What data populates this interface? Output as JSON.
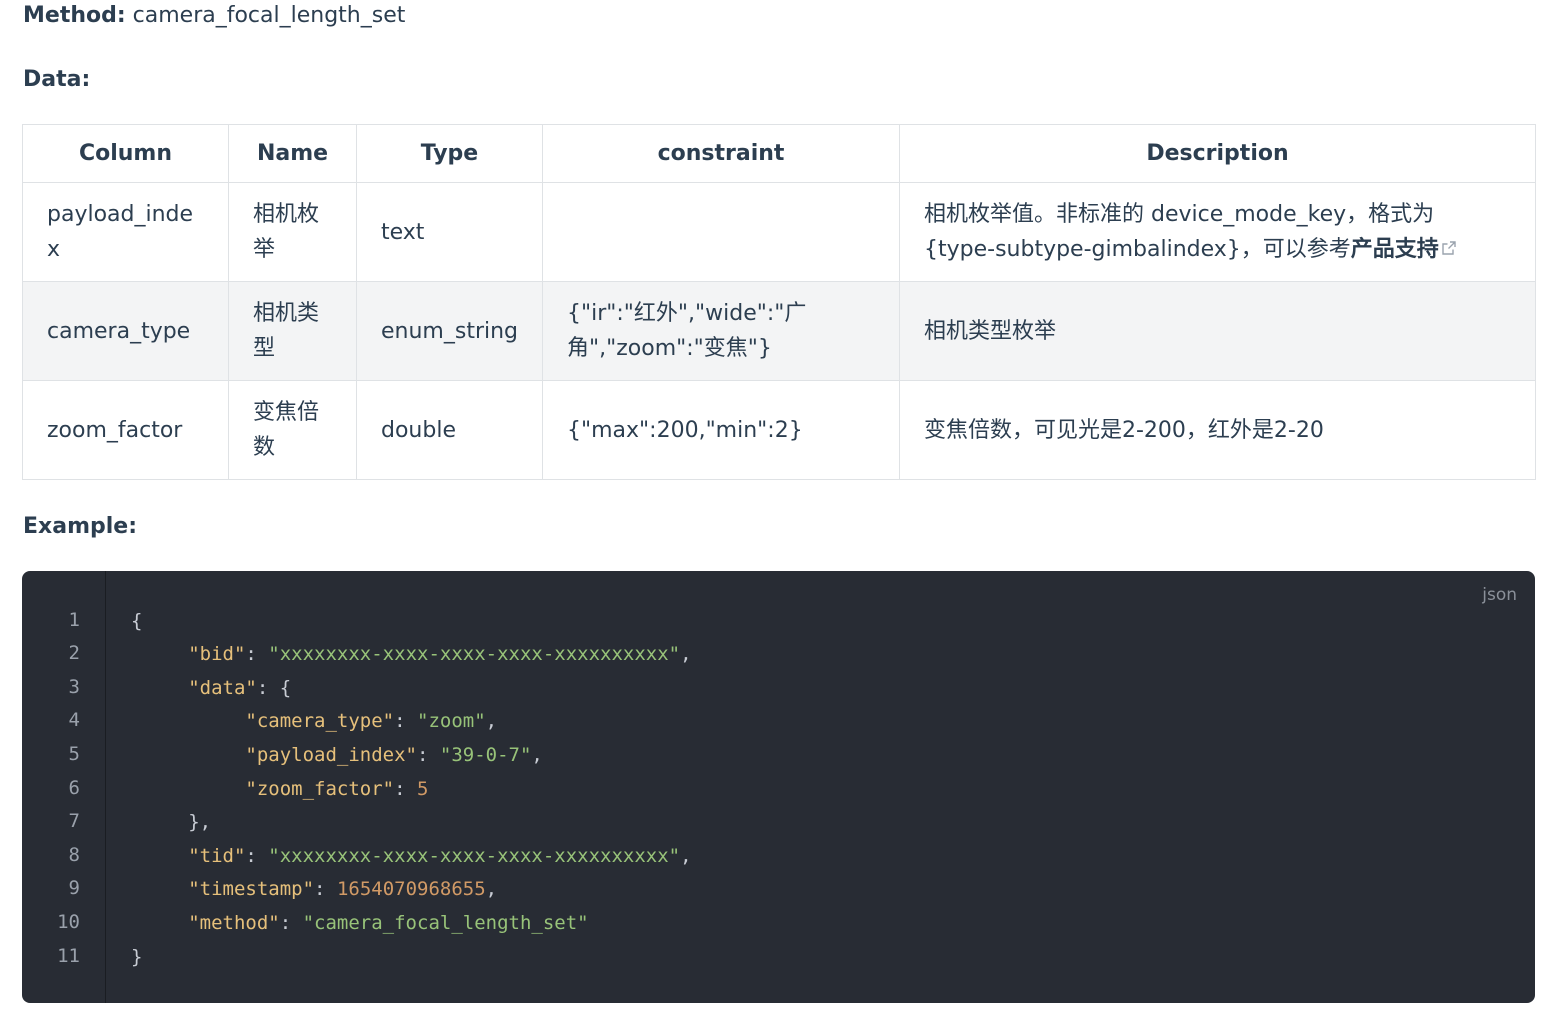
{
  "method": {
    "label": "Method:",
    "value": "camera_focal_length_set"
  },
  "data_heading": "Data:",
  "table": {
    "headers": [
      "Column",
      "Name",
      "Type",
      "constraint",
      "Description"
    ],
    "rows": [
      {
        "column": "payload_index",
        "name": "相机枚举",
        "type": "text",
        "constraint": "",
        "description": "相机枚举值。非标准的 device_mode_key，格式为 {type-subtype-gimbalindex}，可以参考",
        "description_link": "产品支持"
      },
      {
        "column": "camera_type",
        "name": "相机类型",
        "type": "enum_string",
        "constraint": "{\"ir\":\"红外\",\"wide\":\"广角\",\"zoom\":\"变焦\"}",
        "description": "相机类型枚举"
      },
      {
        "column": "zoom_factor",
        "name": "变焦倍数",
        "type": "double",
        "constraint": "{\"max\":200,\"min\":2}",
        "description": "变焦倍数，可见光是2-200，红外是2-20"
      }
    ]
  },
  "example_heading": "Example:",
  "code": {
    "language": "json",
    "line_numbers": [
      "1",
      "2",
      "3",
      "4",
      "5",
      "6",
      "7",
      "8",
      "9",
      "10",
      "11"
    ],
    "bid_key": "\"bid\"",
    "bid_value": "\"xxxxxxxx-xxxx-xxxx-xxxx-xxxxxxxxxx\"",
    "data_key": "\"data\"",
    "camera_type_key": "\"camera_type\"",
    "camera_type_value": "\"zoom\"",
    "payload_index_key": "\"payload_index\"",
    "payload_index_value": "\"39-0-7\"",
    "zoom_factor_key": "\"zoom_factor\"",
    "zoom_factor_value": "5",
    "tid_key": "\"tid\"",
    "tid_value": "\"xxxxxxxx-xxxx-xxxx-xxxx-xxxxxxxxxx\"",
    "timestamp_key": "\"timestamp\"",
    "timestamp_value": "1654070968655",
    "method_key": "\"method\"",
    "method_value": "\"camera_focal_length_set\""
  }
}
